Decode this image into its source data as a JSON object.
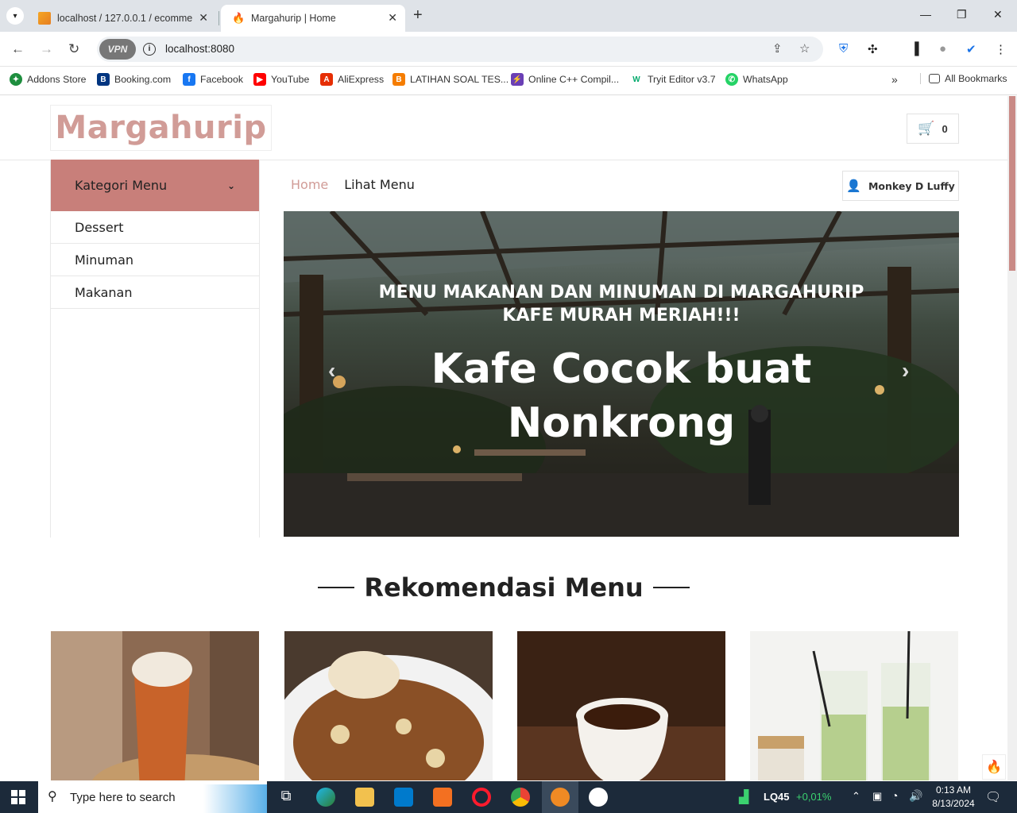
{
  "browser": {
    "tabs": [
      {
        "title": "localhost / 127.0.0.1 / ecommer",
        "icon": "phpmyadmin-icon"
      },
      {
        "title": "Margahurip | Home",
        "icon": "flame-icon"
      }
    ],
    "vpn_label": "VPN",
    "url": "localhost:8080",
    "bookmarks": [
      "Addons Store",
      "Booking.com",
      "Facebook",
      "YouTube",
      "AliExpress",
      "LATIHAN SOAL TES...",
      "Online C++ Compil...",
      "Tryit Editor v3.7",
      "WhatsApp"
    ],
    "all_bookmarks": "All Bookmarks"
  },
  "site": {
    "logo": "Margahurip",
    "cart_count": "0",
    "category_header": "Kategori Menu",
    "categories": [
      "Dessert",
      "Minuman",
      "Makanan"
    ],
    "nav": [
      "Home",
      "Lihat Menu"
    ],
    "user_name": "Monkey D Luffy",
    "hero": {
      "subtitle": "MENU MAKANAN DAN MINUMAN DI MARGAHURIP KAFE MURAH MERIAH!!!",
      "title": "Kafe Cocok buat Nonkrong"
    },
    "section_title": "Rekomendasi Menu",
    "accent_color": "#d19c97"
  },
  "taskbar": {
    "search_placeholder": "Type here to search",
    "stock_name": "LQ45",
    "stock_change": "+0,01%",
    "time": "0:13 AM",
    "date": "8/13/2024"
  }
}
